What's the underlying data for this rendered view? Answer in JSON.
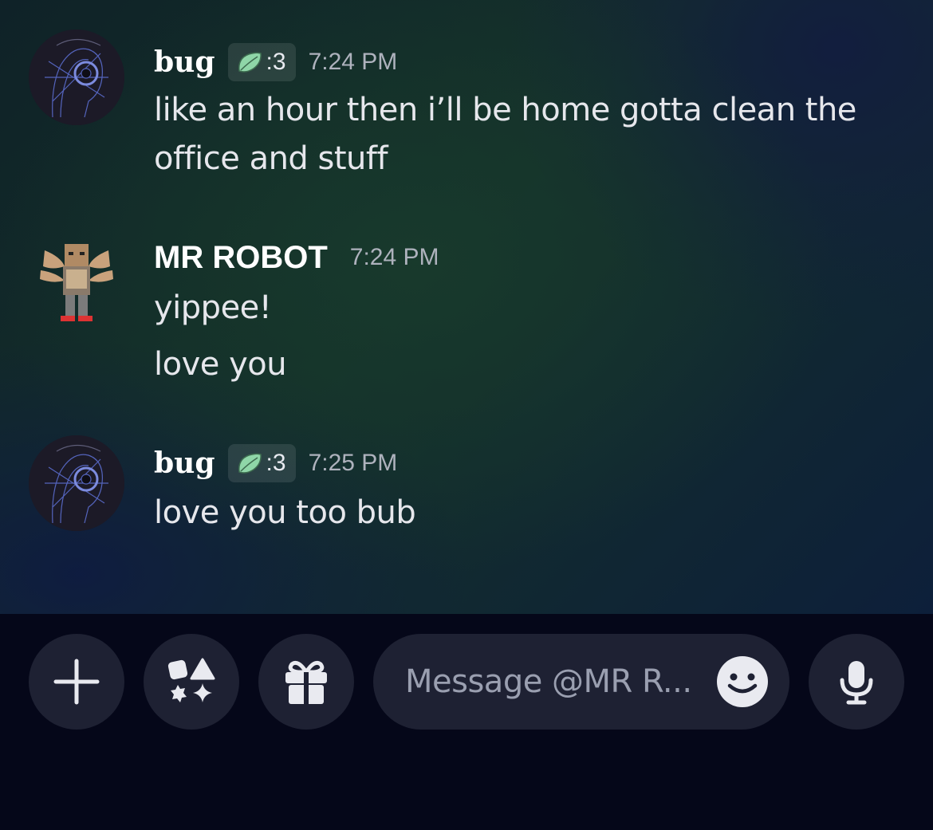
{
  "messages": [
    {
      "author": "bug",
      "tag_text": ":3",
      "tag_icon": "leaf-icon",
      "time": "7:24 PM",
      "lines": [
        "like an hour then i’ll be home gotta clean the",
        "office and stuff"
      ]
    },
    {
      "author": "MR ROBOT",
      "time": "7:24 PM",
      "lines": [
        "yippee!",
        "love you"
      ]
    },
    {
      "author": "bug",
      "tag_text": ":3",
      "tag_icon": "leaf-icon",
      "time": "7:25 PM",
      "lines": [
        "love you too bub"
      ]
    }
  ],
  "composer": {
    "placeholder": "Message @MR R...",
    "buttons": [
      "plus-icon",
      "apps-icon",
      "gift-icon",
      "emoji-icon",
      "microphone-icon"
    ]
  },
  "colors": {
    "composer_bg": "#050719",
    "button_bg": "#1e2133",
    "leaf": "#8fd6a8"
  }
}
